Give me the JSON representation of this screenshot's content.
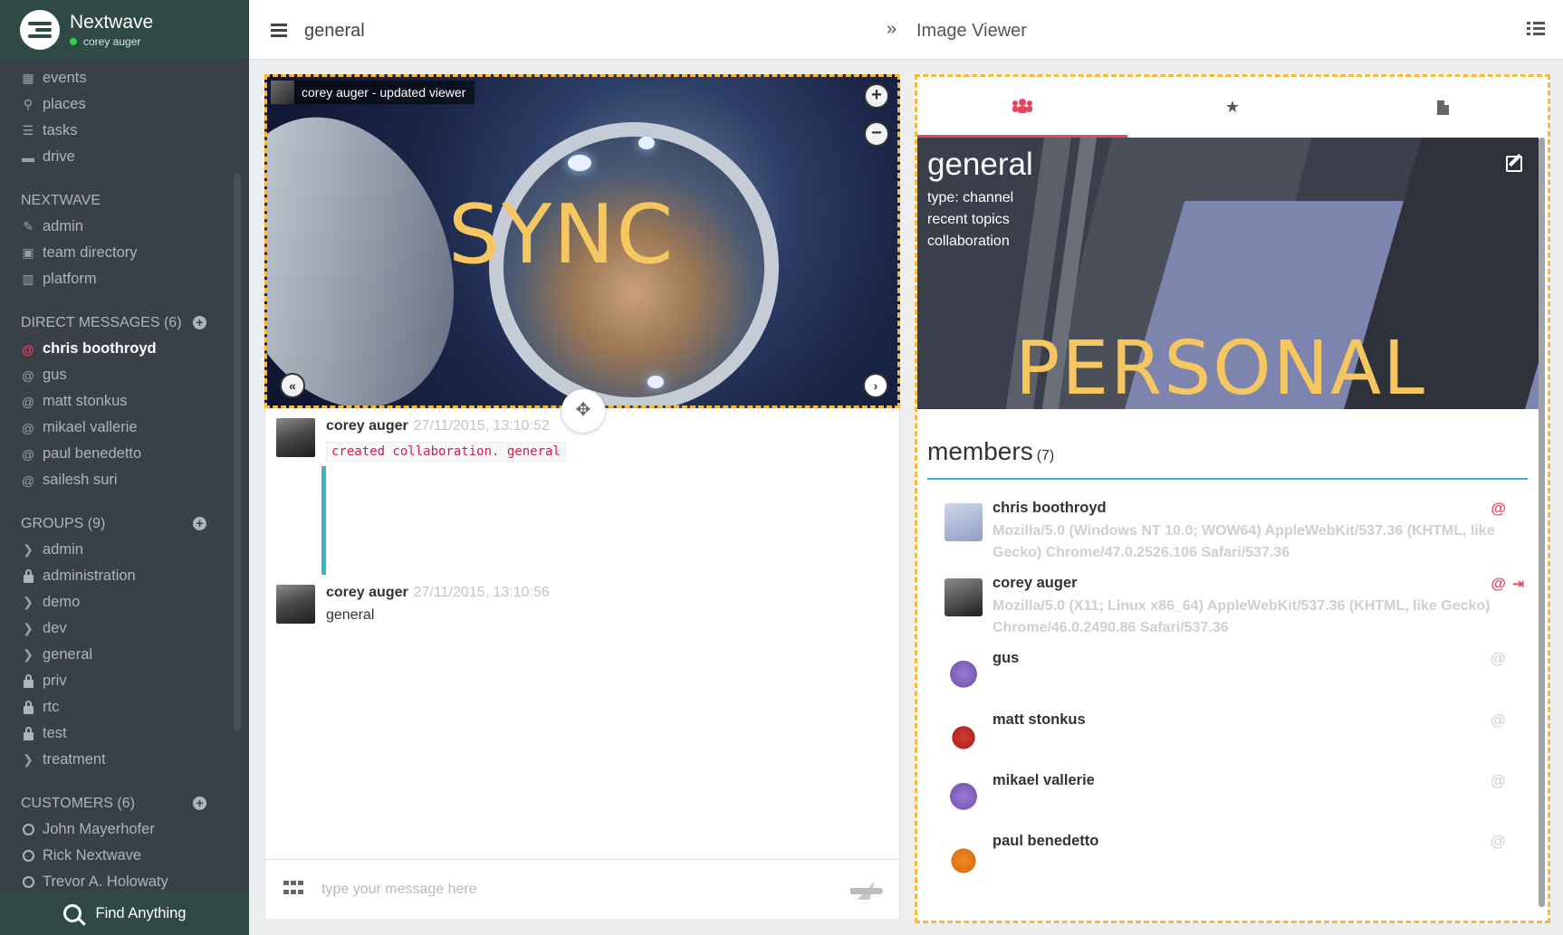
{
  "app": {
    "name": "Nextwave",
    "user": "corey auger"
  },
  "sidebar": {
    "top_items": [
      {
        "label": "events",
        "icon": "calendar-icon"
      },
      {
        "label": "places",
        "icon": "map-marker-icon"
      },
      {
        "label": "tasks",
        "icon": "tasks-icon"
      },
      {
        "label": "drive",
        "icon": "folder-icon"
      }
    ],
    "nextwave": {
      "title": "NEXTWAVE",
      "items": [
        {
          "label": "admin",
          "icon": "wrench-icon"
        },
        {
          "label": "team directory",
          "icon": "briefcase-icon"
        },
        {
          "label": "platform",
          "icon": "bar-chart-icon"
        }
      ]
    },
    "direct_messages": {
      "title": "DIRECT MESSAGES (6)",
      "items": [
        "chris boothroyd",
        "gus",
        "matt stonkus",
        "mikael vallerie",
        "paul benedetto",
        "sailesh suri"
      ],
      "active": "chris boothroyd"
    },
    "groups": {
      "title": "GROUPS (9)",
      "items": [
        {
          "label": "admin",
          "icon": "chevron-right-icon"
        },
        {
          "label": "administration",
          "icon": "lock-icon"
        },
        {
          "label": "demo",
          "icon": "chevron-right-icon"
        },
        {
          "label": "dev",
          "icon": "chevron-right-icon"
        },
        {
          "label": "general",
          "icon": "chevron-right-icon"
        },
        {
          "label": "priv",
          "icon": "lock-icon"
        },
        {
          "label": "rtc",
          "icon": "lock-icon"
        },
        {
          "label": "test",
          "icon": "lock-icon"
        },
        {
          "label": "treatment",
          "icon": "chevron-right-icon"
        }
      ]
    },
    "customers": {
      "title": "CUSTOMERS (6)",
      "items": [
        "John Mayerhofer",
        "Rick Nextwave",
        "Trevor A. Holowaty"
      ]
    },
    "find": "Find Anything"
  },
  "topbar": {
    "channel": "general",
    "right_title": "Image Viewer"
  },
  "viewer": {
    "caption": "corey auger - updated viewer",
    "overlay_text": "SYNC"
  },
  "messages": [
    {
      "author": "corey auger",
      "time": "27/11/2015, 13:10:52",
      "code": "created collaboration. general"
    },
    {
      "author": "corey auger",
      "time": "27/11/2015, 13:10:56",
      "text": "general"
    }
  ],
  "composer": {
    "placeholder": "type your message here"
  },
  "details": {
    "name": "general",
    "type": "type: channel",
    "recent": "recent topics",
    "collab": "collaboration",
    "overlay_text": "PERSONAL",
    "members_title": "members",
    "members_count": "(7)",
    "members": [
      {
        "name": "chris boothroyd",
        "ua": "Mozilla/5.0 (Windows NT 10.0; WOW64) AppleWebKit/537.36 (KHTML, like Gecko) Chrome/47.0.2526.106 Safari/537.36",
        "at": "@",
        "online": true
      },
      {
        "name": "corey auger",
        "ua": "Mozilla/5.0 (X11; Linux x86_64) AppleWebKit/537.36 (KHTML, like Gecko) Chrome/46.0.2490.86 Safari/537.36",
        "at": "@",
        "online": true
      },
      {
        "name": "gus",
        "ua": "",
        "at": "@",
        "online": false
      },
      {
        "name": "matt stonkus",
        "ua": "",
        "at": "@",
        "online": false
      },
      {
        "name": "mikael vallerie",
        "ua": "",
        "at": "@",
        "online": false
      },
      {
        "name": "paul benedetto",
        "ua": "",
        "at": "@",
        "online": false
      }
    ]
  },
  "colors": {
    "accent": "#e8435f",
    "teal": "#3bb3c3",
    "highlight": "#f6c760",
    "sidebar": "#3a4048",
    "sidebar_header": "#2f4a44"
  }
}
